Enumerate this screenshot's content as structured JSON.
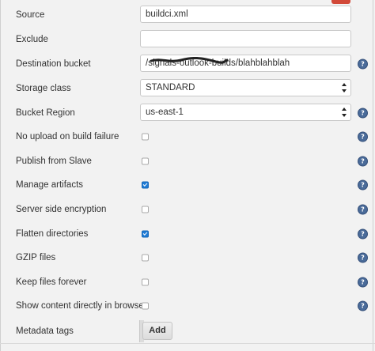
{
  "form": {
    "source": {
      "label": "Source",
      "value": "buildci.xml"
    },
    "exclude": {
      "label": "Exclude",
      "value": ""
    },
    "destination_bucket": {
      "label": "Destination bucket",
      "value": "/signals-outlook-builds/blahblahblah"
    },
    "storage_class": {
      "label": "Storage class",
      "selected": "STANDARD"
    },
    "bucket_region": {
      "label": "Bucket Region",
      "selected": "us-east-1"
    },
    "no_upload_on_failure": {
      "label": "No upload on build failure",
      "checked": false
    },
    "publish_from_slave": {
      "label": "Publish from Slave",
      "checked": false
    },
    "manage_artifacts": {
      "label": "Manage artifacts",
      "checked": true
    },
    "server_side_encryption": {
      "label": "Server side encryption",
      "checked": false
    },
    "flatten_directories": {
      "label": "Flatten directories",
      "checked": true
    },
    "gzip_files": {
      "label": "GZIP files",
      "checked": false
    },
    "keep_files_forever": {
      "label": "Keep files forever",
      "checked": false
    },
    "show_content_in_browser": {
      "label": "Show content directly in browser",
      "checked": false
    },
    "metadata_tags": {
      "label": "Metadata tags",
      "add_label": "Add"
    }
  },
  "help_icon_glyph": "?",
  "colors": {
    "accent_checkbox": "#1e7bd6",
    "help_icon": "#4a6b99",
    "delete_button": "#d24939"
  }
}
